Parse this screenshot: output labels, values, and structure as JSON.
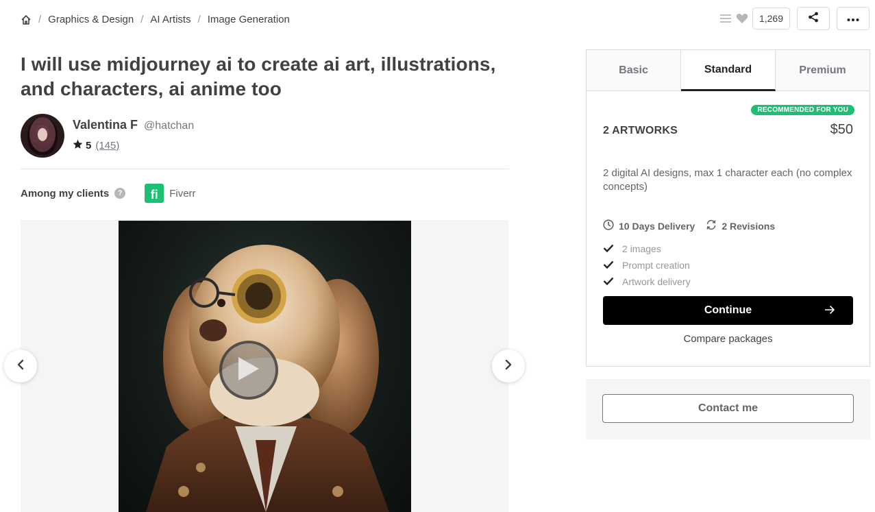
{
  "breadcrumb": {
    "items": [
      "Graphics & Design",
      "AI Artists",
      "Image Generation"
    ],
    "separator": "/"
  },
  "actions": {
    "likes_count": "1,269"
  },
  "gig": {
    "title": "I will use midjourney ai to create ai art, illustrations, and characters, ai anime too"
  },
  "seller": {
    "name": "Valentina F",
    "handle": "@hatchan",
    "rating": "5",
    "review_count": "(145)"
  },
  "clients": {
    "label": "Among my clients",
    "help_glyph": "?",
    "client_logo_letters": "fi",
    "client_name": "Fiverr"
  },
  "packages": {
    "tabs": [
      "Basic",
      "Standard",
      "Premium"
    ],
    "active_tab": "Standard",
    "badge": "RECOMMENDED FOR YOU",
    "name": "2 ARTWORKS",
    "price": "$50",
    "description": "2 digital AI designs, max 1 character each (no complex concepts)",
    "delivery": "10 Days Delivery",
    "revisions": "2 Revisions",
    "features": [
      "2 images",
      "Prompt creation",
      "Artwork delivery"
    ],
    "continue_label": "Continue",
    "compare_label": "Compare packages"
  },
  "contact": {
    "label": "Contact me"
  },
  "colors": {
    "brand_green": "#1dbf73",
    "text_dark": "#404145",
    "button_black": "#000000"
  }
}
